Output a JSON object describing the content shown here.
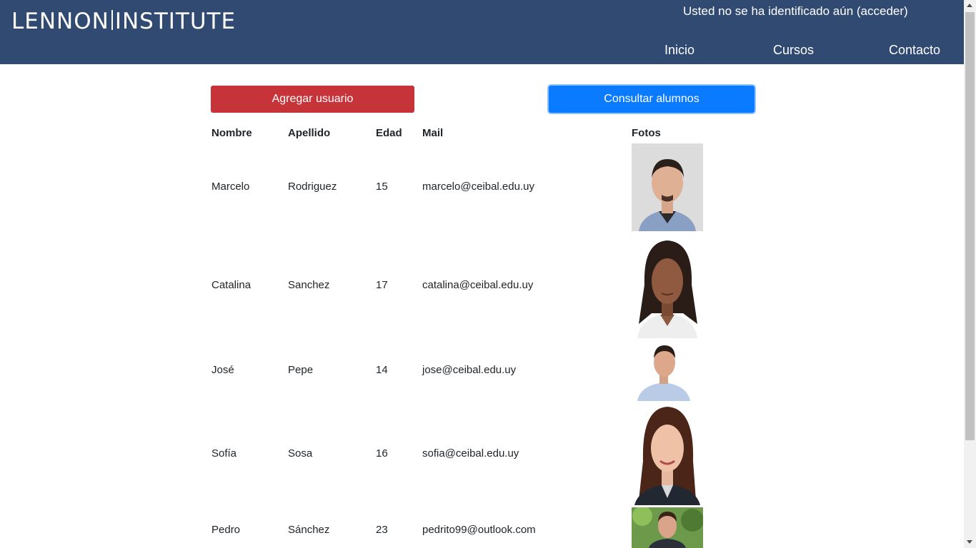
{
  "header": {
    "logo_left": "LENNON",
    "logo_right": "INSTITUTE",
    "login_status": "Usted no se ha identificado aún (acceder)",
    "nav": {
      "inicio": "Inicio",
      "cursos": "Cursos",
      "contacto": "Contacto"
    },
    "bg_color": "#314a72"
  },
  "actions": {
    "add_user_label": "Agregar usuario",
    "add_user_color": "#c6343a",
    "consult_label": "Consultar alumnos",
    "consult_color": "#0a7bff"
  },
  "table": {
    "headers": {
      "nombre": "Nombre",
      "apellido": "Apellido",
      "edad": "Edad",
      "mail": "Mail",
      "fotos": "Fotos"
    },
    "rows": [
      {
        "nombre": "Marcelo",
        "apellido": "Rodriguez",
        "edad": "15",
        "mail": "marcelo@ceibal.edu.uy",
        "photo": "man-portrait"
      },
      {
        "nombre": "Catalina",
        "apellido": "Sanchez",
        "edad": "17",
        "mail": "catalina@ceibal.edu.uy",
        "photo": "woman-portrait"
      },
      {
        "nombre": "José",
        "apellido": "Pepe",
        "edad": "14",
        "mail": "jose@ceibal.edu.uy",
        "photo": "man-portrait"
      },
      {
        "nombre": "Sofía",
        "apellido": "Sosa",
        "edad": "16",
        "mail": "sofia@ceibal.edu.uy",
        "photo": "woman-portrait"
      },
      {
        "nombre": "Pedro",
        "apellido": "Sánchez",
        "edad": "23",
        "mail": "pedrito99@outlook.com",
        "photo": "man-portrait-outdoor"
      }
    ]
  }
}
